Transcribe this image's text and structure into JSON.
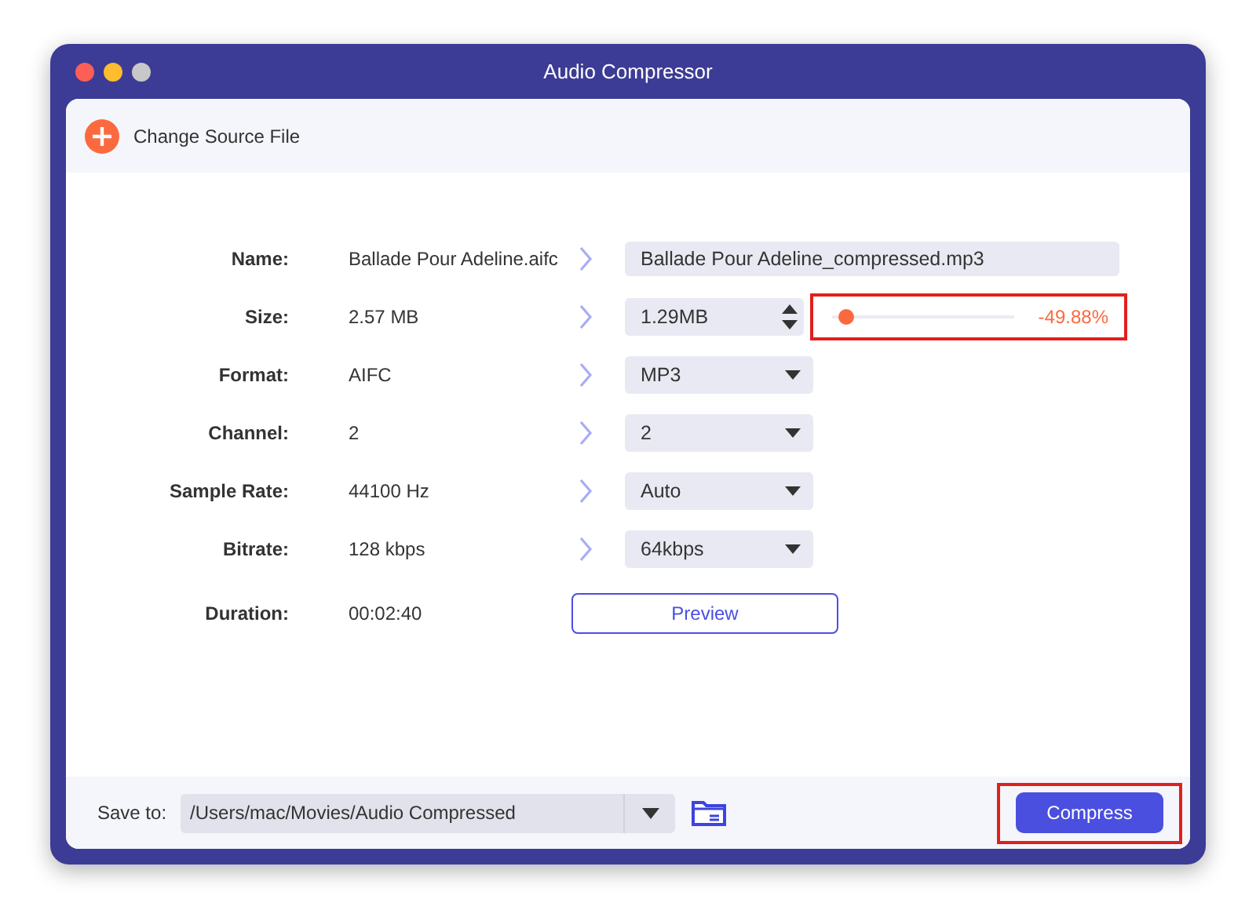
{
  "window": {
    "title": "Audio Compressor"
  },
  "toolbar": {
    "change_source": "Change Source File"
  },
  "rows": [
    {
      "kind": "text",
      "label": "Name:",
      "source": "Ballade Pour Adeline.aifc",
      "target": "Ballade Pour Adeline_compressed.mp3"
    },
    {
      "kind": "size",
      "label": "Size:",
      "source": "2.57 MB",
      "target": "1.29MB",
      "level": 0.04,
      "reading": "-49.88%",
      "highlighted": true
    },
    {
      "kind": "dropdown",
      "label": "Format:",
      "source": "AIFC",
      "target": "MP3"
    },
    {
      "kind": "dropdown",
      "label": "Channel:",
      "source": "2",
      "target": "2"
    },
    {
      "kind": "dropdown",
      "label": "Sample Rate:",
      "source": "44100 Hz",
      "target": "Auto"
    },
    {
      "kind": "dropdown",
      "label": "Bitrate:",
      "source": "128 kbps",
      "target": "64kbps"
    },
    {
      "kind": "button",
      "label": "Duration:",
      "source": "00:02:40",
      "target": "Preview"
    }
  ],
  "footer": {
    "save_label": "Save to:",
    "path": "/Users/mac/Movies/Audio Compressed",
    "compress": "Compress",
    "highlighted": true
  }
}
